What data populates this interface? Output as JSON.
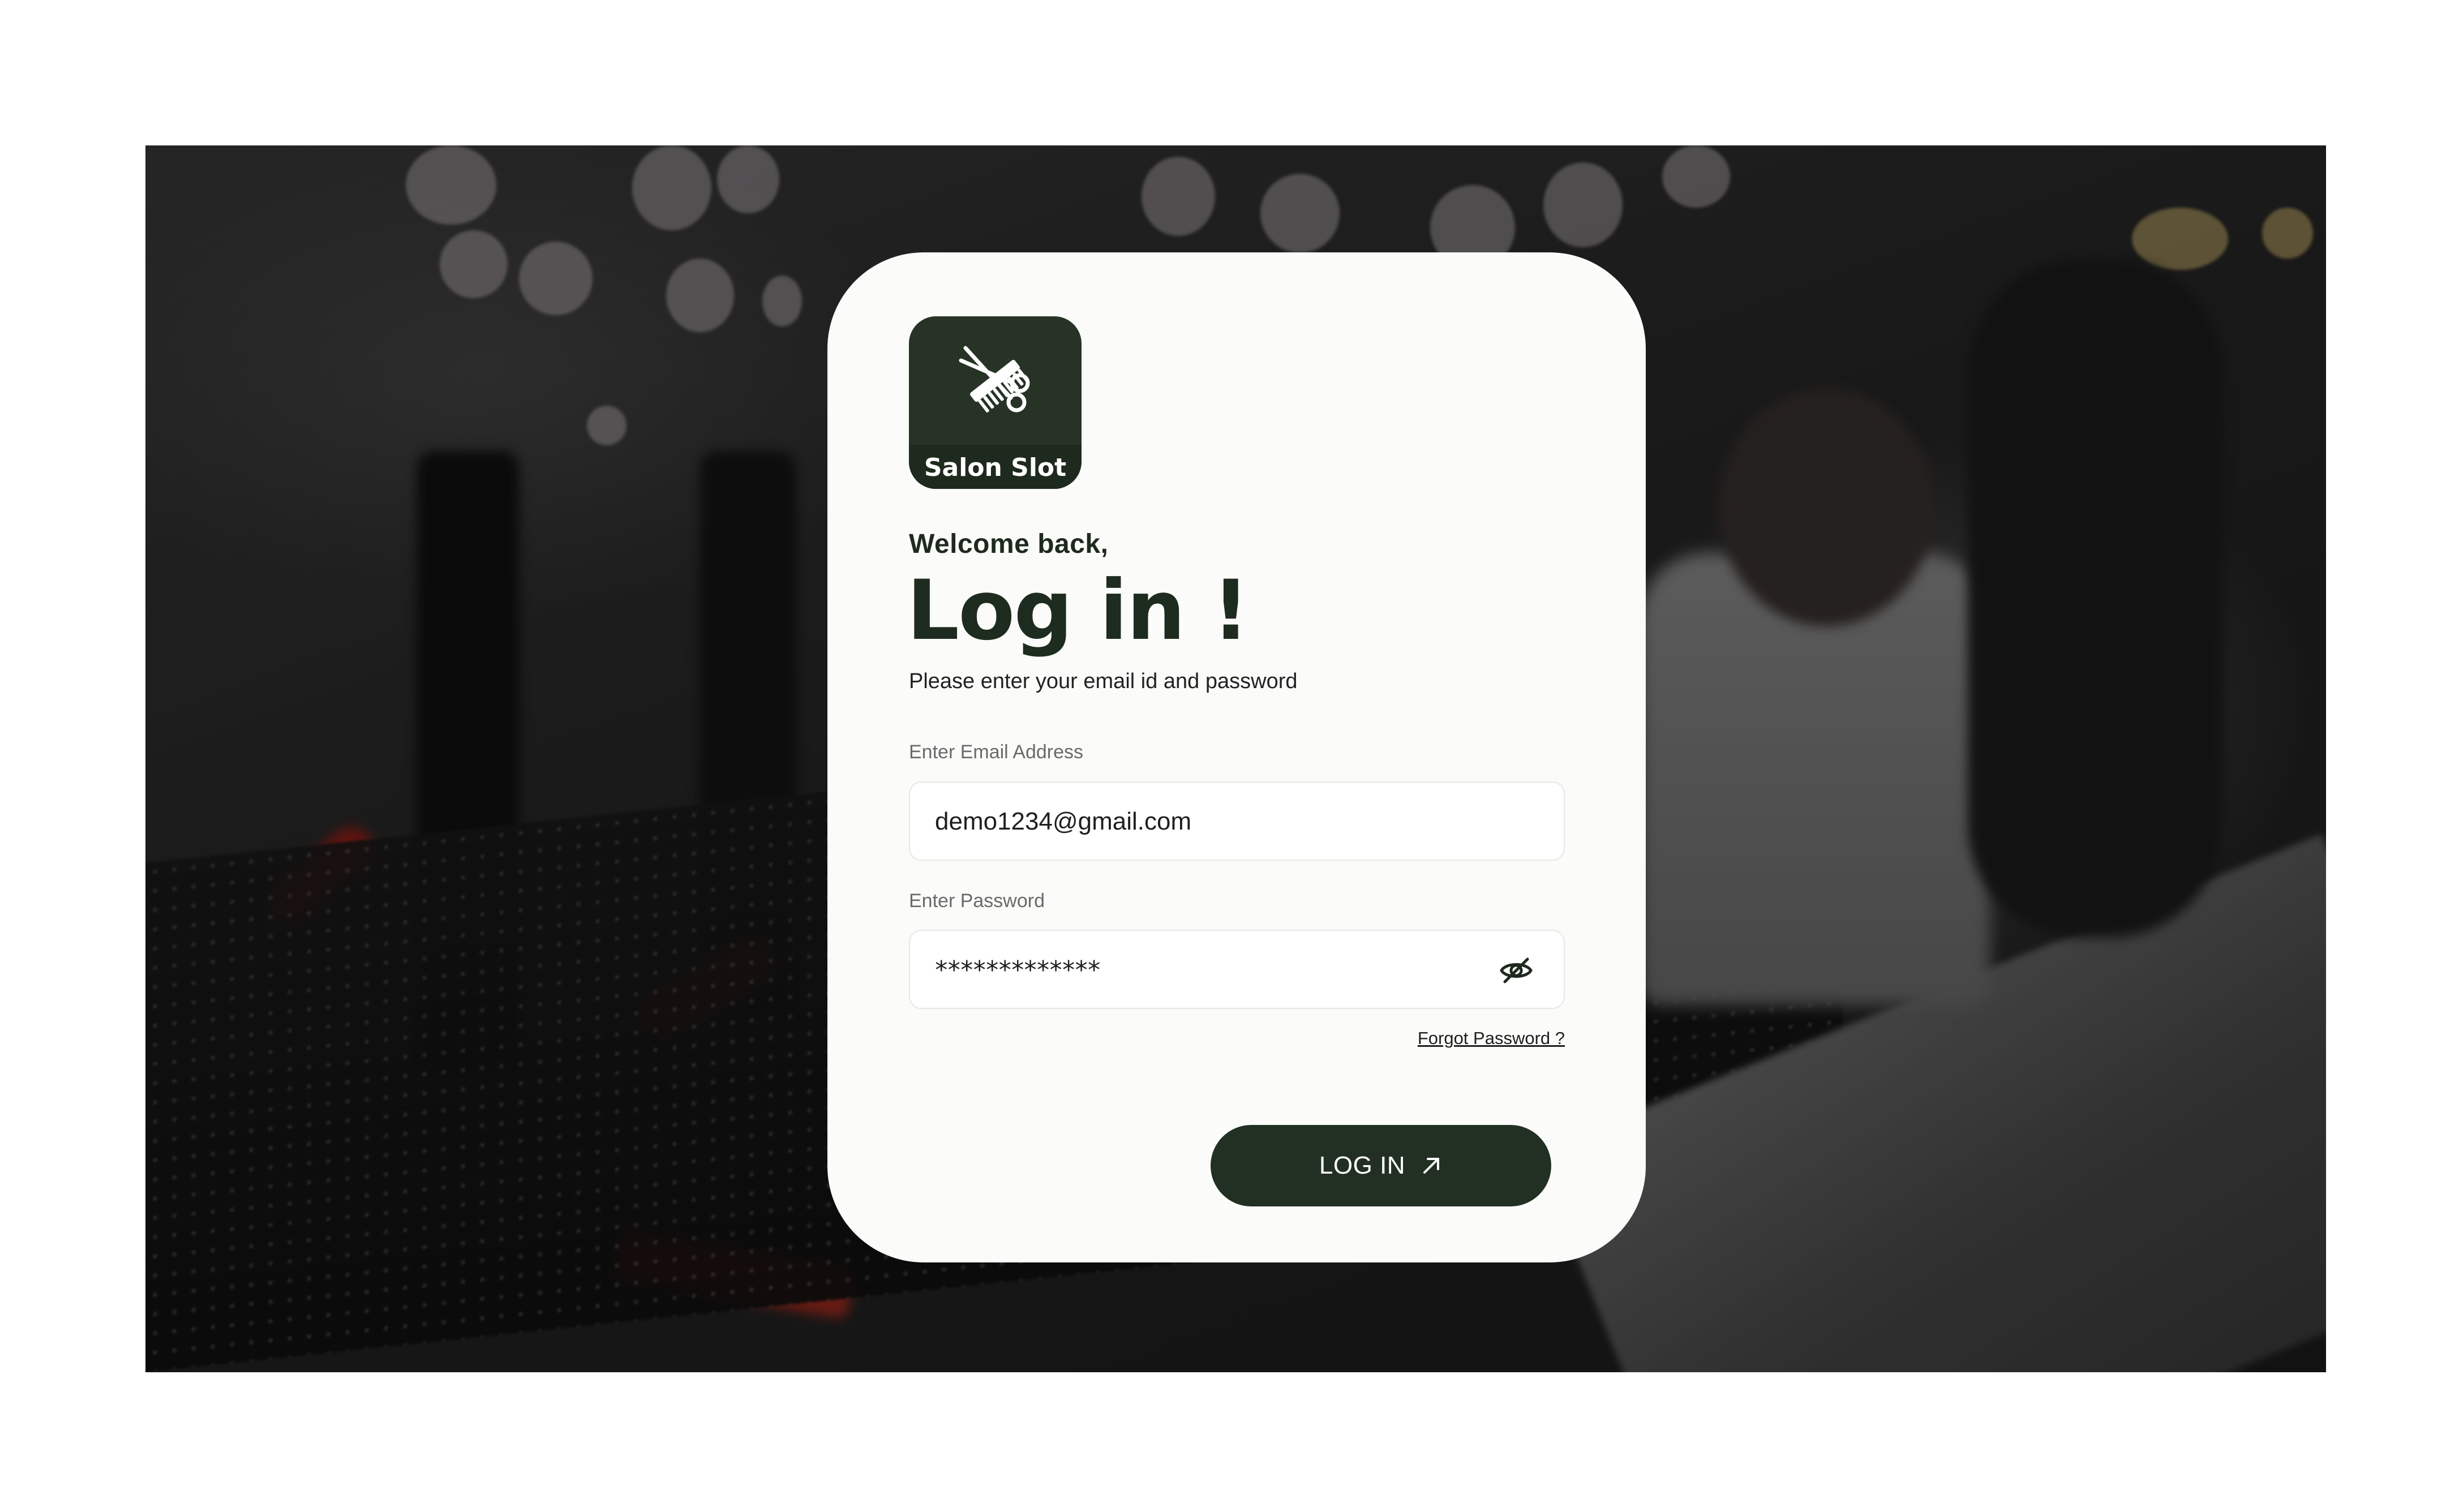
{
  "brand": {
    "name": "Salon Slot",
    "logo_icon": "scissors-comb-icon",
    "primary_color": "#223023",
    "card_color": "#fbfcf9"
  },
  "header": {
    "welcome": "Welcome back,",
    "title": "Log in !",
    "subtitle": "Please enter your email id and password"
  },
  "form": {
    "email": {
      "label": "Enter Email Address",
      "value": "demo1234@gmail.com"
    },
    "password": {
      "label": "Enter Password",
      "masked_value": "*************",
      "toggle_icon": "eye-off-icon"
    },
    "forgot_link": "Forgot Password ?",
    "submit": {
      "label": "LOG IN",
      "icon": "arrow-up-right-icon"
    }
  }
}
